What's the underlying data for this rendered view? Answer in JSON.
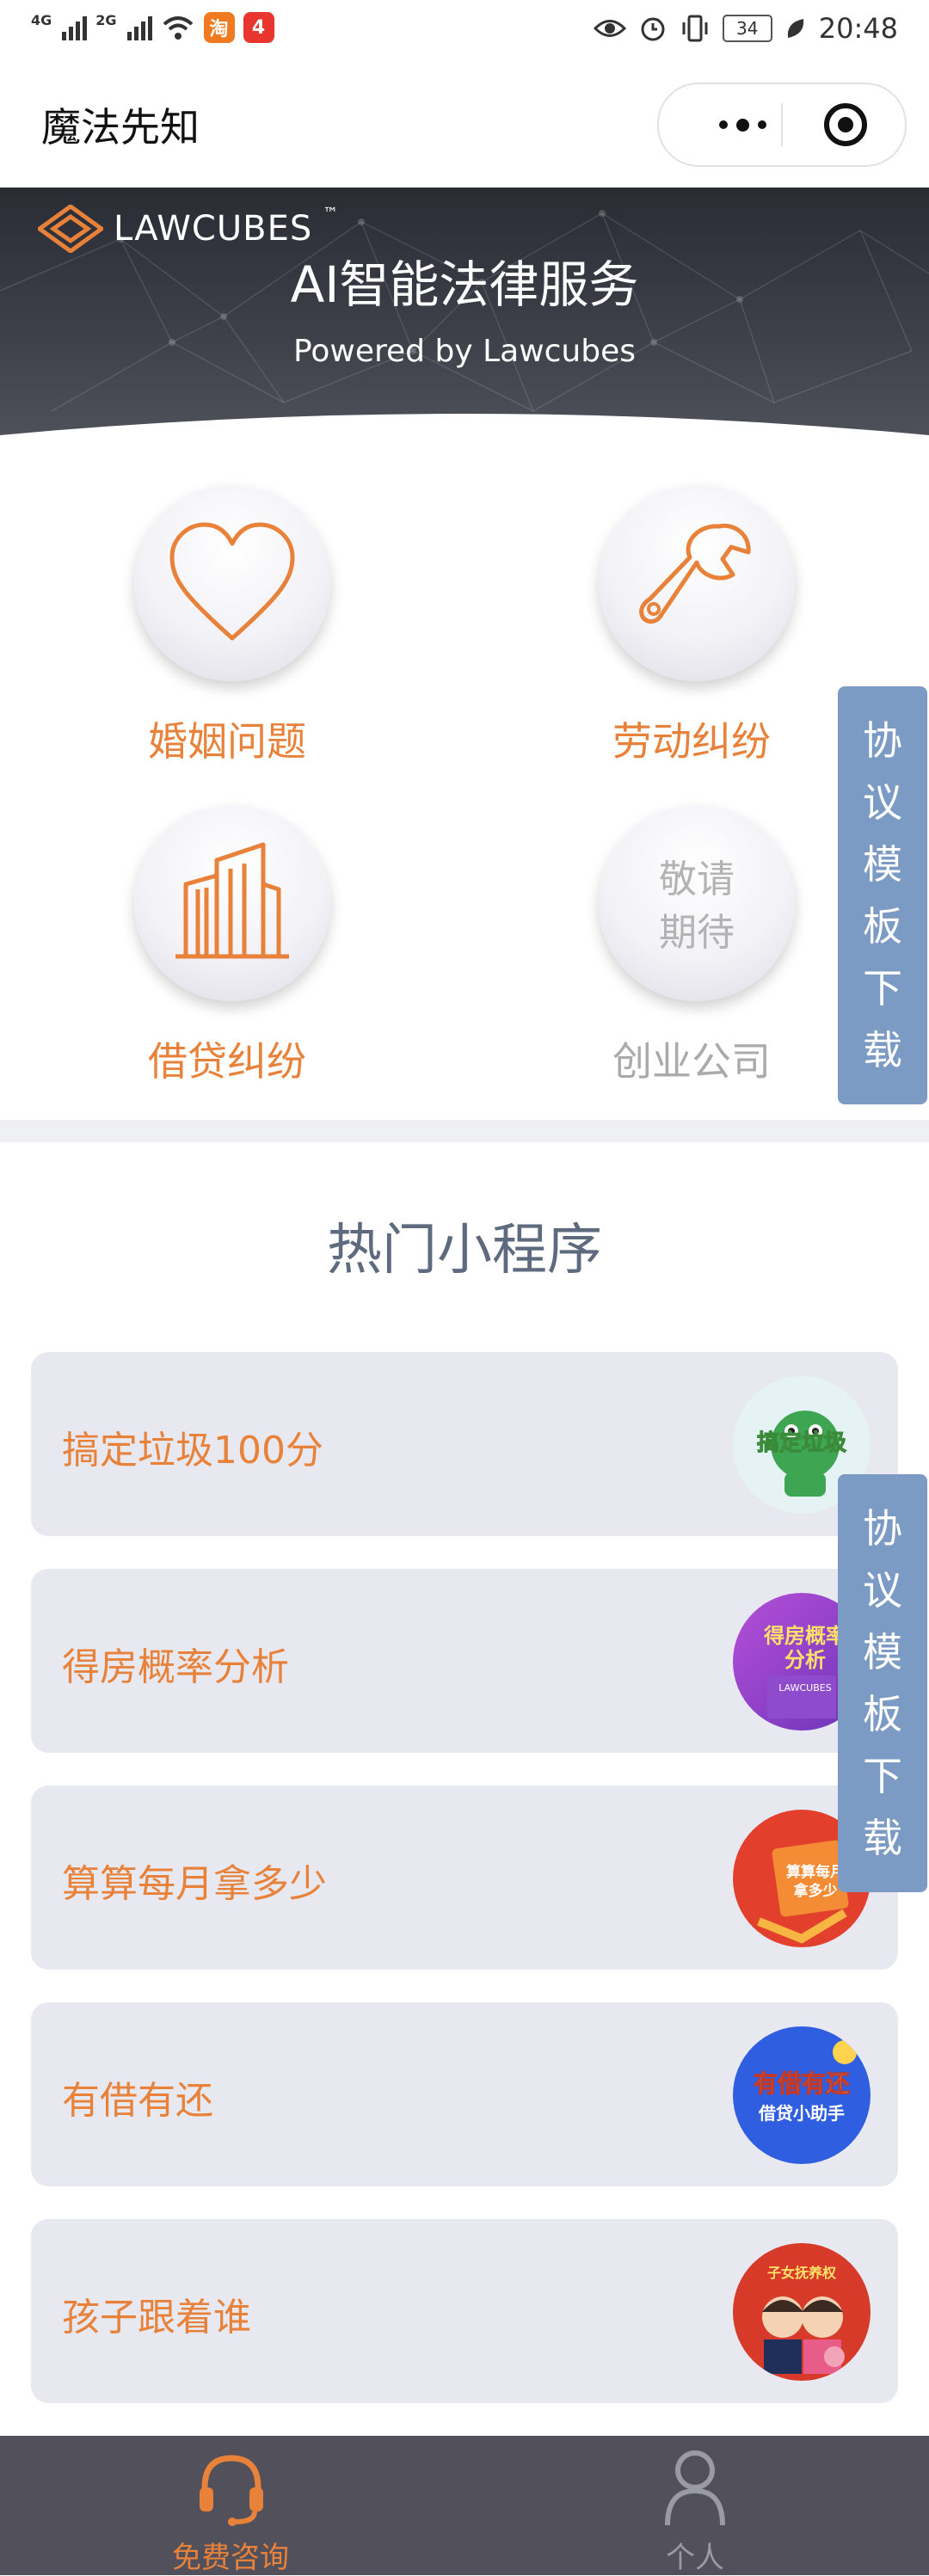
{
  "status_bar": {
    "network_1": "4G",
    "network_2": "2G",
    "app_badge_1": "淘",
    "app_badge_2": "4",
    "battery": "34",
    "time": "20:48"
  },
  "navbar": {
    "title": "魔法先知"
  },
  "banner": {
    "logo_text": "LAWCUBES",
    "trademark": "™",
    "title": "AI智能法律服务",
    "subtitle": "Powered by Lawcubes"
  },
  "categories": [
    {
      "label": "婚姻问题",
      "icon": "heart-icon"
    },
    {
      "label": "劳动纠纷",
      "icon": "wrench-icon"
    },
    {
      "label": "借贷纠纷",
      "icon": "building-icon"
    },
    {
      "label": "创业公司",
      "icon": "coming-soon",
      "soon_line1": "敬请",
      "soon_line2": "期待"
    }
  ],
  "floating_button": {
    "chars": [
      "协",
      "议",
      "模",
      "板",
      "下",
      "载"
    ]
  },
  "hot_section": {
    "title": "热门小程序",
    "items": [
      {
        "label": "搞定垃圾100分",
        "thumb_text": "搞定垃圾"
      },
      {
        "label": "得房概率分析",
        "thumb_text_1": "得房概率",
        "thumb_text_2": "分析",
        "thumb_small": "LAWCUBES"
      },
      {
        "label": "算算每月拿多少",
        "thumb_text_1": "算算每月",
        "thumb_text_2": "拿多少"
      },
      {
        "label": "有借有还",
        "thumb_text_1": "有借有还",
        "thumb_text_2": "借贷小助手"
      },
      {
        "label": "孩子跟着谁",
        "thumb_text": "子女抚养权"
      }
    ]
  },
  "tabbar": {
    "tabs": [
      {
        "label": "免费咨询",
        "active": true
      },
      {
        "label": "个人",
        "active": false
      }
    ]
  },
  "colors": {
    "accent": "#e8823a",
    "floating": "#7b9ac4",
    "tabbar_bg": "#52505a",
    "card_bg": "#e8e8f0",
    "section_title": "#5e6a7e"
  }
}
